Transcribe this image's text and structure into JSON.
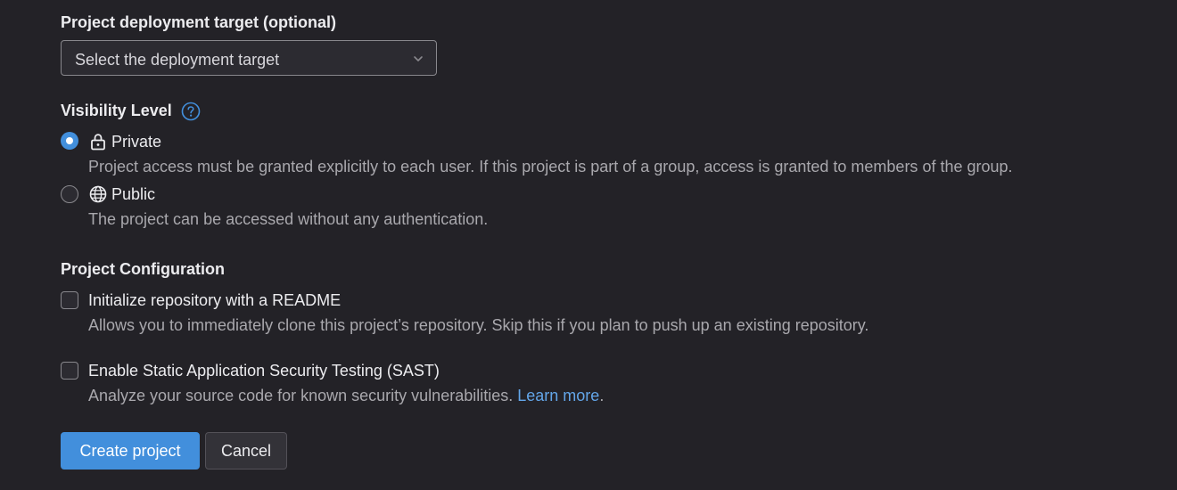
{
  "deployment_target": {
    "label": "Project deployment target (optional)",
    "select_value": "Select the deployment target"
  },
  "visibility": {
    "label": "Visibility Level",
    "options": [
      {
        "title": "Private",
        "icon": "lock-icon",
        "description": "Project access must be granted explicitly to each user. If this project is part of a group, access is granted to members of the group.",
        "checked": true
      },
      {
        "title": "Public",
        "icon": "globe-icon",
        "description": "The project can be accessed without any authentication.",
        "checked": false
      }
    ]
  },
  "configuration": {
    "label": "Project Configuration",
    "readme": {
      "label": "Initialize repository with a README",
      "help": "Allows you to immediately clone this project’s repository. Skip this if you plan to push up an existing repository.",
      "checked": false
    },
    "sast": {
      "label": "Enable Static Application Security Testing (SAST)",
      "help": "Analyze your source code for known security vulnerabilities.",
      "link_text": "Learn more",
      "help_suffix": ".",
      "checked": false
    }
  },
  "actions": {
    "create_label": "Create project",
    "cancel_label": "Cancel"
  },
  "colors": {
    "background": "#232227",
    "accent": "#428fdc",
    "link": "#63a6e9"
  }
}
